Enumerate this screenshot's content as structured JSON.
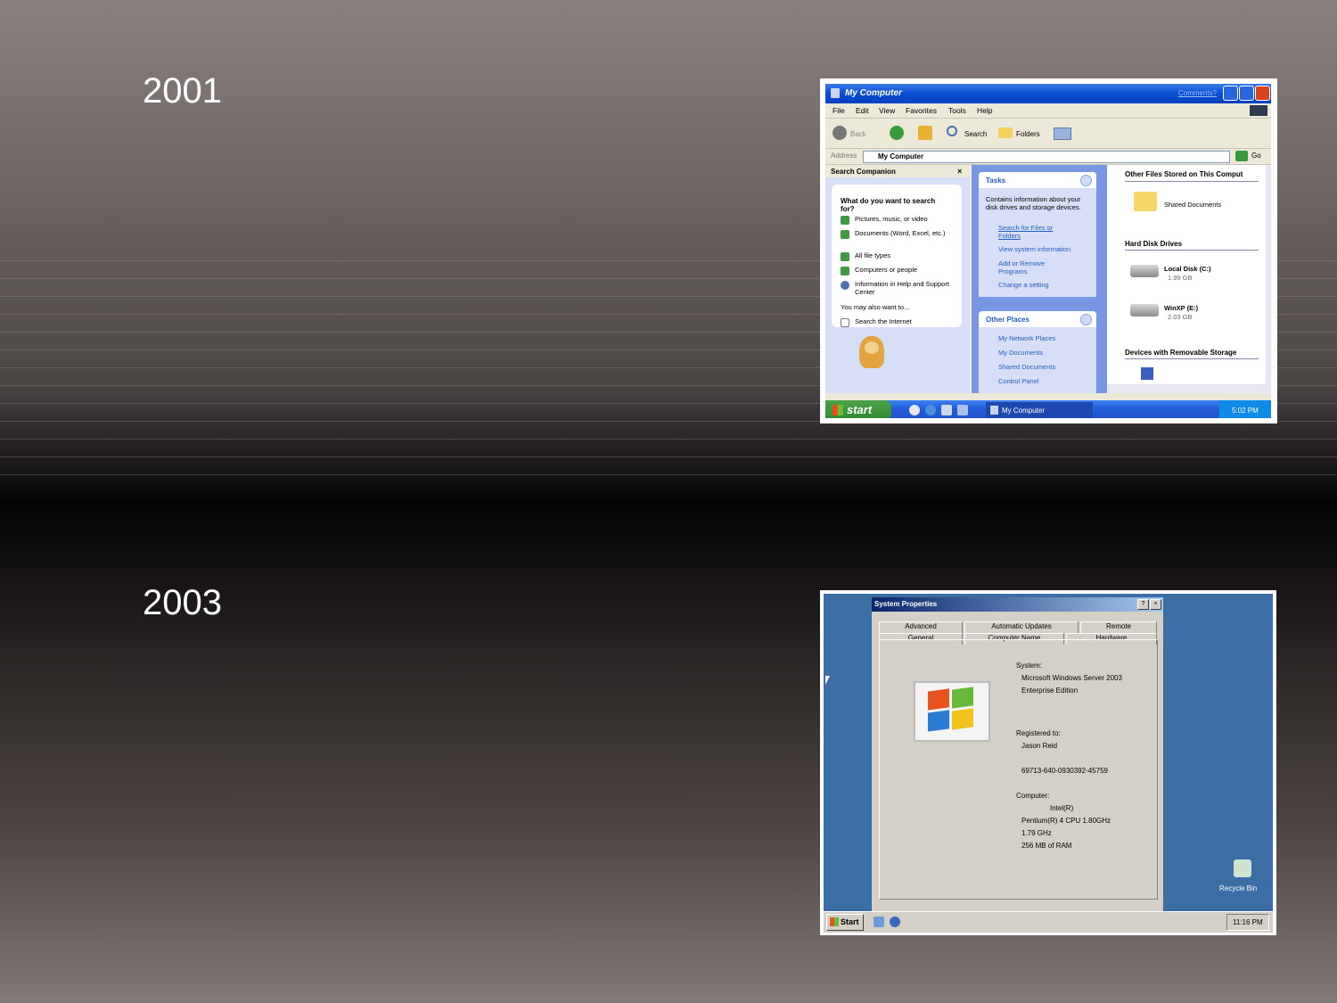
{
  "slide": {
    "year_top": "2001",
    "year_bottom": "2003"
  },
  "xp": {
    "title": "My Computer",
    "title_link": "Comments?",
    "menu": [
      "File",
      "Edit",
      "View",
      "Favorites",
      "Tools",
      "Help"
    ],
    "toolbar": {
      "back": "Back",
      "search": "Search",
      "folders": "Folders"
    },
    "address_label": "Address",
    "address_value": "My Computer",
    "go_label": "Go",
    "search_companion": {
      "header": "Search Companion",
      "question": "What do you want to search for?",
      "options": [
        "Pictures, music, or video",
        "Documents (Word, Excel, etc.)",
        "All file types",
        "Computers or people",
        "Information in Help and Support Center"
      ],
      "also": "You may also want to...",
      "internet": "Search the Internet"
    },
    "tasks": {
      "header": "Tasks",
      "desc": "Contains information about your disk drives and storage devices.",
      "items": [
        "Search for Files or Folders",
        "View system information",
        "Add or Remove Programs",
        "Change a setting"
      ]
    },
    "other_places": {
      "header": "Other Places",
      "items": [
        "My Network Places",
        "My Documents",
        "Shared Documents",
        "Control Panel"
      ]
    },
    "files": {
      "section_files": "Other Files Stored on This Comput",
      "shared_docs": "Shared Documents",
      "section_hdd": "Hard Disk Drives",
      "disk_c_name": "Local Disk (C:)",
      "disk_c_size": "1.99 GB",
      "disk_e_name": "WinXP (E:)",
      "disk_e_size": "2.03 GB",
      "section_removable": "Devices with Removable Storage"
    },
    "taskbar": {
      "start": "start",
      "window": "My Computer",
      "clock": "5:02 PM"
    }
  },
  "s2003": {
    "title": "System Properties",
    "tabs_row1": [
      "Advanced",
      "Automatic Updates",
      "Remote"
    ],
    "tabs_row2": [
      "General",
      "Computer Name",
      "Hardware"
    ],
    "system_label": "System:",
    "os_name": "Microsoft Windows Server 2003",
    "edition": "Enterprise Edition",
    "registered_label": "Registered to:",
    "registered_name": "Jason Reid",
    "product_id": "69713-640-0930392-45759",
    "computer_label": "Computer:",
    "cpu_brand": "Intel(R)",
    "cpu_model": "Pentium(R) 4 CPU 1.80GHz",
    "cpu_speed": "1.79 GHz",
    "ram": "256 MB of RAM",
    "recycle": "Recycle Bin",
    "start": "Start",
    "clock": "11:16 PM"
  }
}
